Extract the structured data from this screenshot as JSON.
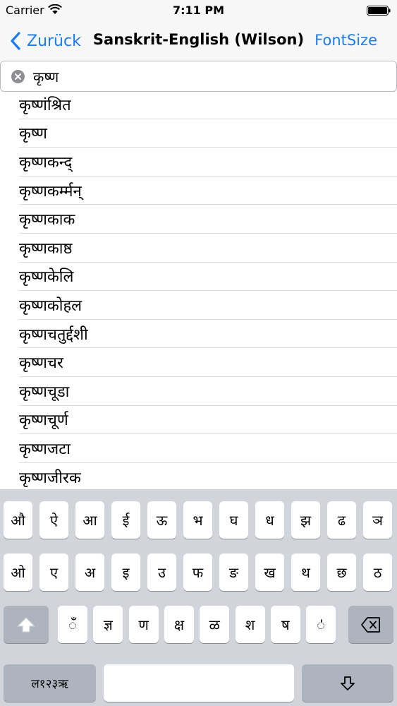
{
  "status_bar": {
    "carrier": "Carrier",
    "time": "7:11 PM"
  },
  "nav": {
    "back_label": "Zurück",
    "title": "Sanskrit-English (Wilson)",
    "fontsize_label": "FontSize"
  },
  "search": {
    "value": "कृष्ण"
  },
  "results": [
    "कृष्णंश्रित",
    "कृष्ण",
    "कृष्णकन्द्",
    "कृष्णकर्म्मन्",
    "कृष्णकाक",
    "कृष्णकाष्ठ",
    "कृष्णकेलि",
    "कृष्णकोहल",
    "कृष्णचतुर्द्दशी",
    "कृष्णचर",
    "कृष्णचूडा",
    "कृष्णचूर्ण",
    "कृष्णजटा",
    "कृष्णजीरक"
  ],
  "keyboard": {
    "row1": [
      "औ",
      "ऐ",
      "आ",
      "ई",
      "ऊ",
      "भ",
      "घ",
      "ध",
      "झ",
      "ढ",
      "ञ"
    ],
    "row2": [
      "ओ",
      "ए",
      "अ",
      "इ",
      "उ",
      "फ",
      "ङ",
      "ख",
      "थ",
      "छ",
      "ठ"
    ],
    "row3": [
      "ँ",
      "ज्ञ",
      "ण",
      "क्ष",
      "ळ",
      "श",
      "ष",
      "ऺ"
    ],
    "mode_key": "ल१२३ऋ",
    "space_label": ""
  },
  "colors": {
    "accent": "#1a7cf5",
    "keyboard_bg": "#d1d5db"
  }
}
